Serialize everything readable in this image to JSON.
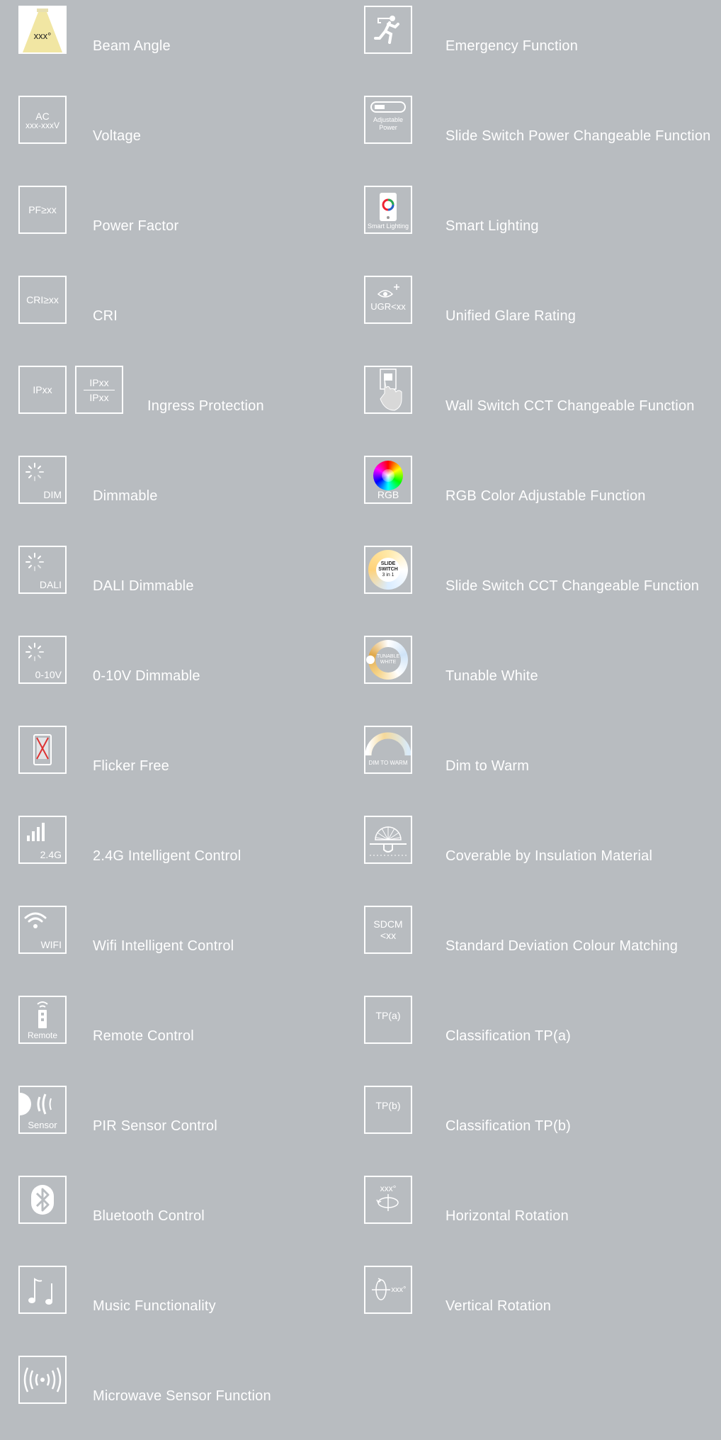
{
  "left": [
    {
      "label": "Beam Angle",
      "badge": "xxx°"
    },
    {
      "label": "Voltage",
      "badge_lines": [
        "AC",
        "xxx-xxxV"
      ]
    },
    {
      "label": "Power Factor",
      "badge": "PF≥xx"
    },
    {
      "label": "CRI",
      "badge": "CRI≥xx"
    },
    {
      "label": "Ingress Protection",
      "badge": "IPxx",
      "badge2_lines": [
        "IPxx",
        "IPxx"
      ]
    },
    {
      "label": "Dimmable",
      "badge": "DIM"
    },
    {
      "label": "DALI Dimmable",
      "badge": "DALI"
    },
    {
      "label": "0-10V Dimmable",
      "badge": "0-10V"
    },
    {
      "label": "Flicker Free"
    },
    {
      "label": "2.4G Intelligent Control",
      "badge": "2.4G"
    },
    {
      "label": "Wifi Intelligent Control",
      "badge": "WIFI"
    },
    {
      "label": "Remote Control",
      "badge": "Remote"
    },
    {
      "label": "PIR Sensor Control",
      "badge": "Sensor"
    },
    {
      "label": "Bluetooth Control"
    },
    {
      "label": "Music Functionality"
    },
    {
      "label": "Microwave Sensor Function"
    }
  ],
  "right": [
    {
      "label": "Emergency Function"
    },
    {
      "label": "Slide Switch Power Changeable Function",
      "badge_lines": [
        "Adjustable",
        "Power"
      ]
    },
    {
      "label": "Smart Lighting",
      "badge": "Smart Lighting"
    },
    {
      "label": "Unified Glare Rating",
      "badge": "UGR<xx"
    },
    {
      "label": "Wall Switch CCT Changeable Function"
    },
    {
      "label": "RGB Color Adjustable Function",
      "badge": "RGB"
    },
    {
      "label": "Slide Switch CCT Changeable Function",
      "badge_lines": [
        "SLIDE",
        "SWITCH",
        "3 in 1"
      ]
    },
    {
      "label": "Tunable White",
      "badge_lines": [
        "TUNABLE",
        "WHITE"
      ]
    },
    {
      "label": "Dim to Warm",
      "badge": "DIM TO WARM"
    },
    {
      "label": "Coverable by Insulation Material"
    },
    {
      "label": "Standard Deviation Colour Matching",
      "badge_lines": [
        "SDCM",
        "<xx"
      ]
    },
    {
      "label": "Classification TP(a)",
      "badge": "TP(a)"
    },
    {
      "label": "Classification TP(b)",
      "badge": "TP(b)"
    },
    {
      "label": "Horizontal Rotation",
      "badge": "xxx°"
    },
    {
      "label": "Vertical Rotation",
      "badge": "xxx°"
    }
  ],
  "colors": {
    "background": "#b8bcc0",
    "foreground": "#ffffff"
  }
}
